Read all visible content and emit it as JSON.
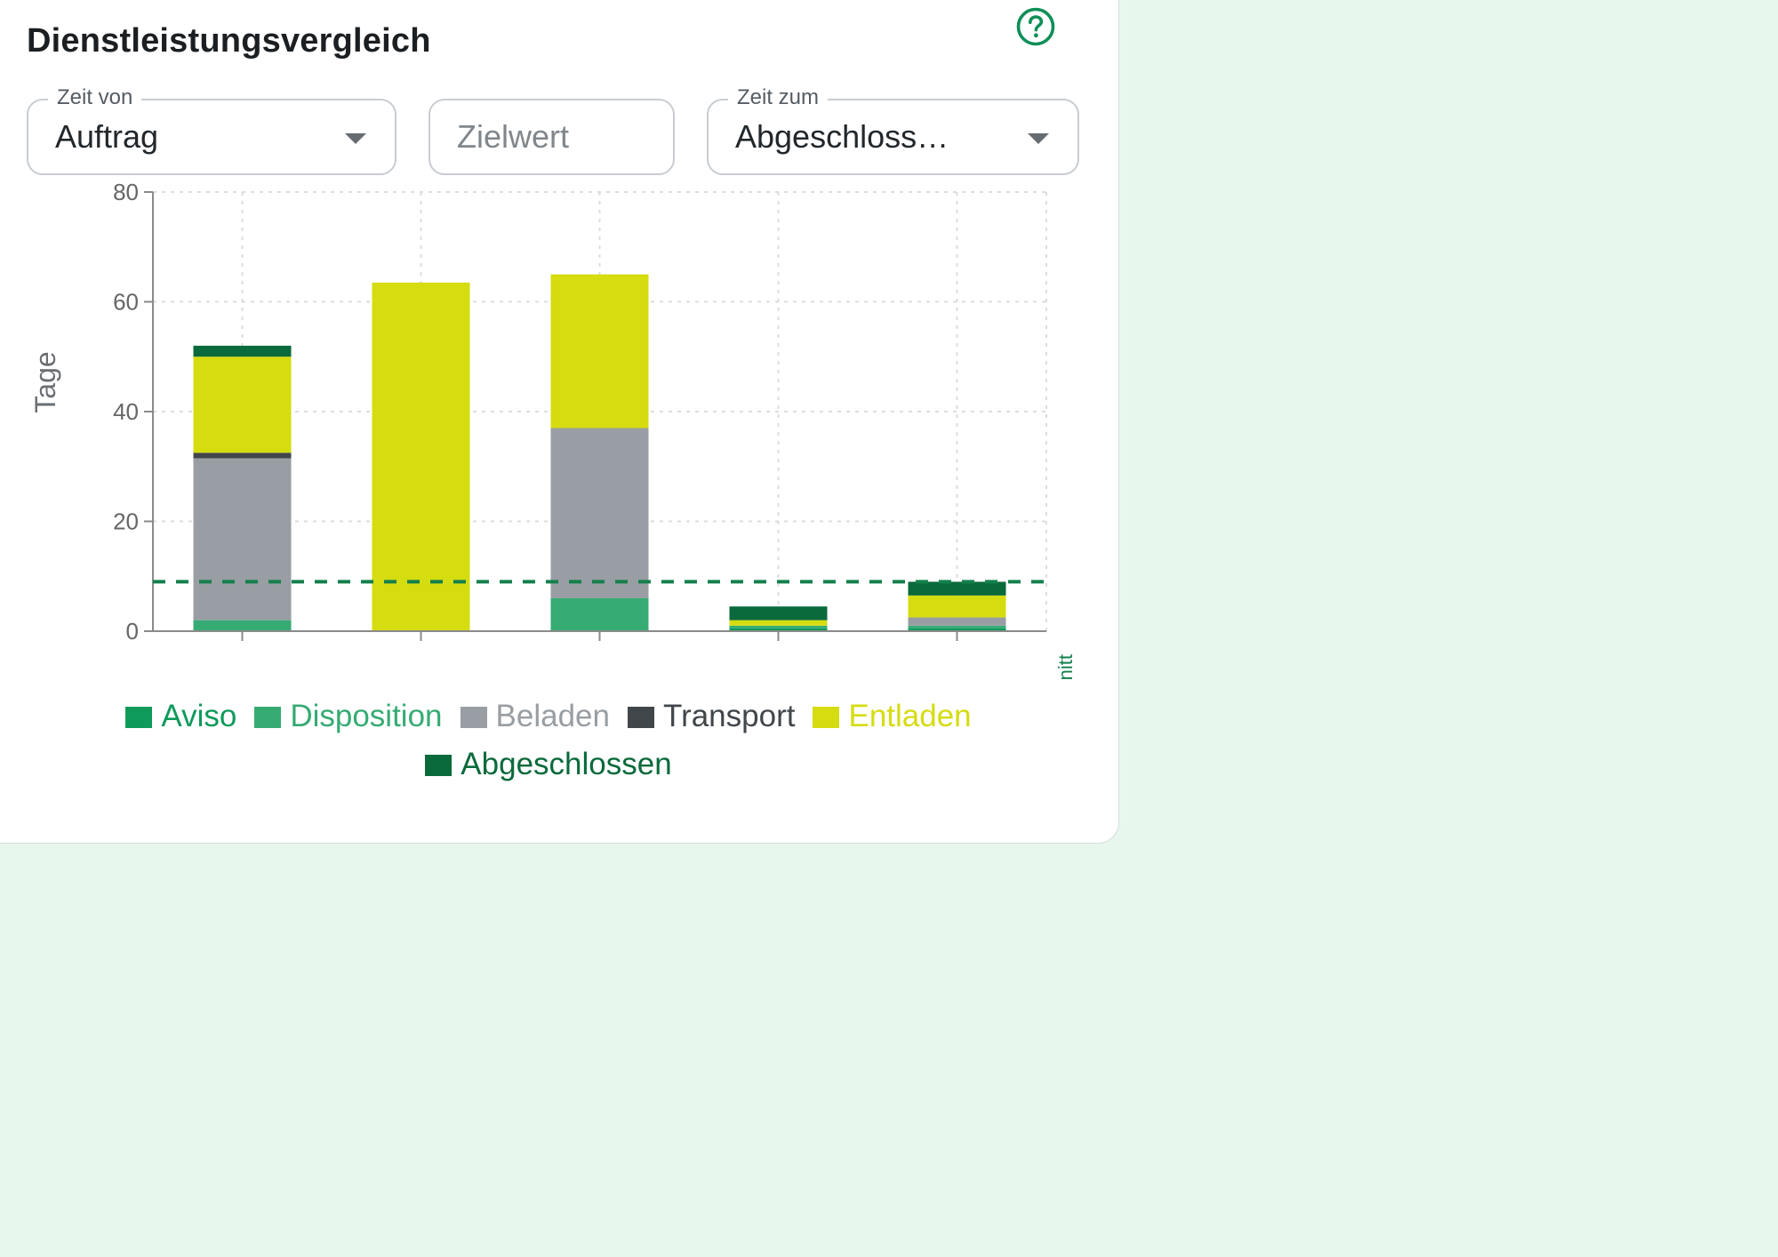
{
  "title": "Dienstleistungsvergleich",
  "help_icon": "question-circle-icon",
  "filters": {
    "from": {
      "label": "Zeit von",
      "value": "Auftrag"
    },
    "target": {
      "placeholder": "Zielwert"
    },
    "to": {
      "label": "Zeit zum",
      "value": "Abgeschloss…"
    }
  },
  "colors": {
    "accent": "#0e8f57",
    "Aviso": "#0e9a5a",
    "Disposition": "#36ab74",
    "Beladen": "#989ea3",
    "Transport": "#41464b",
    "Entladen": "#d5dc0f",
    "Abgeschlossen": "#0a6a3b",
    "average_line": "#13804c"
  },
  "chart_data": {
    "type": "bar",
    "stacked": true,
    "categories": [
      "",
      "",
      "",
      "",
      ""
    ],
    "series": [
      {
        "name": "Aviso",
        "values": [
          0,
          0,
          0,
          0.5,
          0.5
        ]
      },
      {
        "name": "Disposition",
        "values": [
          2,
          0,
          6,
          0.5,
          0.5
        ]
      },
      {
        "name": "Beladen",
        "values": [
          29.5,
          0,
          31,
          0,
          1.5
        ]
      },
      {
        "name": "Transport",
        "values": [
          1,
          0,
          0,
          0,
          0
        ]
      },
      {
        "name": "Entladen",
        "values": [
          17.5,
          63.5,
          28,
          1,
          4
        ]
      },
      {
        "name": "Abgeschlossen",
        "values": [
          2,
          0,
          0,
          2.5,
          2.5
        ]
      }
    ],
    "ylabel": "Tage",
    "ylim": [
      0,
      80
    ],
    "yticks": [
      "0",
      "20",
      "40",
      "60",
      "80"
    ],
    "grid": true,
    "reference_line": {
      "label": "Durchschnitt",
      "value": 9
    },
    "legend_position": "bottom"
  }
}
